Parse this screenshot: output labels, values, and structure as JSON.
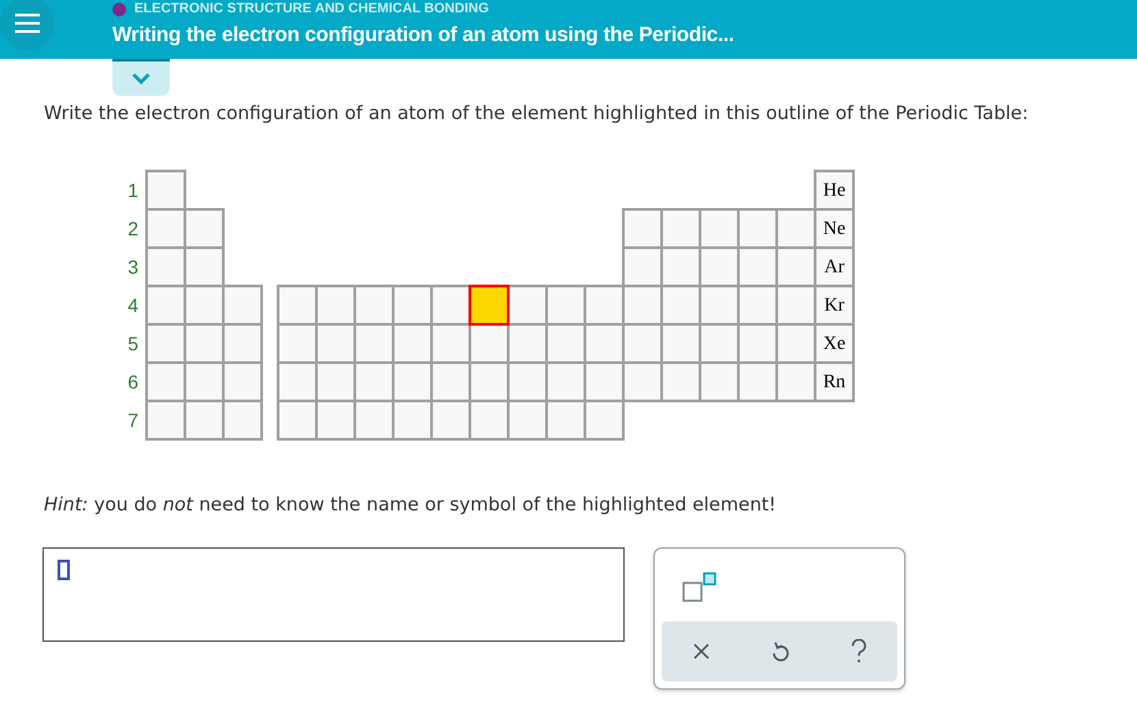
{
  "header": {
    "category": "ELECTRONIC STRUCTURE AND CHEMICAL BONDING",
    "title": "Writing the electron configuration of an atom using the Periodic..."
  },
  "question": "Write the electron configuration of an atom of the element highlighted in this outline of the Periodic Table:",
  "periodic_table": {
    "rows": [
      {
        "label": "1",
        "cells": [
          {
            "kind": "box",
            "highlighted": false
          },
          {
            "kind": "none"
          },
          {
            "kind": "none"
          },
          {
            "kind": "none"
          },
          {
            "kind": "none"
          },
          {
            "kind": "none"
          },
          {
            "kind": "none"
          },
          {
            "kind": "none"
          },
          {
            "kind": "none"
          },
          {
            "kind": "none"
          },
          {
            "kind": "none"
          },
          {
            "kind": "none"
          },
          {
            "kind": "none"
          },
          {
            "kind": "none"
          },
          {
            "kind": "none"
          },
          {
            "kind": "none"
          },
          {
            "kind": "none"
          },
          {
            "kind": "box",
            "highlighted": false,
            "symbol": "He"
          }
        ]
      },
      {
        "label": "2",
        "cells": [
          {
            "kind": "box",
            "highlighted": false
          },
          {
            "kind": "box",
            "highlighted": false
          },
          {
            "kind": "none"
          },
          {
            "kind": "none"
          },
          {
            "kind": "none"
          },
          {
            "kind": "none"
          },
          {
            "kind": "none"
          },
          {
            "kind": "none"
          },
          {
            "kind": "none"
          },
          {
            "kind": "none"
          },
          {
            "kind": "none"
          },
          {
            "kind": "none"
          },
          {
            "kind": "box",
            "highlighted": false
          },
          {
            "kind": "box",
            "highlighted": false
          },
          {
            "kind": "box",
            "highlighted": false
          },
          {
            "kind": "box",
            "highlighted": false
          },
          {
            "kind": "box",
            "highlighted": false
          },
          {
            "kind": "box",
            "highlighted": false,
            "symbol": "Ne"
          }
        ]
      },
      {
        "label": "3",
        "cells": [
          {
            "kind": "box",
            "highlighted": false
          },
          {
            "kind": "box",
            "highlighted": false
          },
          {
            "kind": "none"
          },
          {
            "kind": "none"
          },
          {
            "kind": "none"
          },
          {
            "kind": "none"
          },
          {
            "kind": "none"
          },
          {
            "kind": "none"
          },
          {
            "kind": "none"
          },
          {
            "kind": "none"
          },
          {
            "kind": "none"
          },
          {
            "kind": "none"
          },
          {
            "kind": "box",
            "highlighted": false
          },
          {
            "kind": "box",
            "highlighted": false
          },
          {
            "kind": "box",
            "highlighted": false
          },
          {
            "kind": "box",
            "highlighted": false
          },
          {
            "kind": "box",
            "highlighted": false
          },
          {
            "kind": "box",
            "highlighted": false,
            "symbol": "Ar"
          }
        ]
      },
      {
        "label": "4",
        "cells": [
          {
            "kind": "box",
            "highlighted": false
          },
          {
            "kind": "box",
            "highlighted": false
          },
          {
            "kind": "box",
            "highlighted": false
          },
          {
            "kind": "box",
            "highlighted": false
          },
          {
            "kind": "box",
            "highlighted": false
          },
          {
            "kind": "box",
            "highlighted": false
          },
          {
            "kind": "box",
            "highlighted": false
          },
          {
            "kind": "box",
            "highlighted": false
          },
          {
            "kind": "box",
            "highlighted": true
          },
          {
            "kind": "box",
            "highlighted": false
          },
          {
            "kind": "box",
            "highlighted": false
          },
          {
            "kind": "box",
            "highlighted": false
          },
          {
            "kind": "box",
            "highlighted": false
          },
          {
            "kind": "box",
            "highlighted": false
          },
          {
            "kind": "box",
            "highlighted": false
          },
          {
            "kind": "box",
            "highlighted": false
          },
          {
            "kind": "box",
            "highlighted": false
          },
          {
            "kind": "box",
            "highlighted": false,
            "symbol": "Kr"
          }
        ]
      },
      {
        "label": "5",
        "cells": [
          {
            "kind": "box",
            "highlighted": false
          },
          {
            "kind": "box",
            "highlighted": false
          },
          {
            "kind": "box",
            "highlighted": false
          },
          {
            "kind": "box",
            "highlighted": false
          },
          {
            "kind": "box",
            "highlighted": false
          },
          {
            "kind": "box",
            "highlighted": false
          },
          {
            "kind": "box",
            "highlighted": false
          },
          {
            "kind": "box",
            "highlighted": false
          },
          {
            "kind": "box",
            "highlighted": false
          },
          {
            "kind": "box",
            "highlighted": false
          },
          {
            "kind": "box",
            "highlighted": false
          },
          {
            "kind": "box",
            "highlighted": false
          },
          {
            "kind": "box",
            "highlighted": false
          },
          {
            "kind": "box",
            "highlighted": false
          },
          {
            "kind": "box",
            "highlighted": false
          },
          {
            "kind": "box",
            "highlighted": false
          },
          {
            "kind": "box",
            "highlighted": false
          },
          {
            "kind": "box",
            "highlighted": false,
            "symbol": "Xe"
          }
        ]
      },
      {
        "label": "6",
        "cells": [
          {
            "kind": "box",
            "highlighted": false
          },
          {
            "kind": "box",
            "highlighted": false
          },
          {
            "kind": "box",
            "highlighted": false
          },
          {
            "kind": "box",
            "highlighted": false
          },
          {
            "kind": "box",
            "highlighted": false
          },
          {
            "kind": "box",
            "highlighted": false
          },
          {
            "kind": "box",
            "highlighted": false
          },
          {
            "kind": "box",
            "highlighted": false
          },
          {
            "kind": "box",
            "highlighted": false
          },
          {
            "kind": "box",
            "highlighted": false
          },
          {
            "kind": "box",
            "highlighted": false
          },
          {
            "kind": "box",
            "highlighted": false
          },
          {
            "kind": "box",
            "highlighted": false
          },
          {
            "kind": "box",
            "highlighted": false
          },
          {
            "kind": "box",
            "highlighted": false
          },
          {
            "kind": "box",
            "highlighted": false
          },
          {
            "kind": "box",
            "highlighted": false
          },
          {
            "kind": "box",
            "highlighted": false,
            "symbol": "Rn"
          }
        ]
      },
      {
        "label": "7",
        "cells": [
          {
            "kind": "box",
            "highlighted": false
          },
          {
            "kind": "box",
            "highlighted": false
          },
          {
            "kind": "box",
            "highlighted": false
          },
          {
            "kind": "box",
            "highlighted": false
          },
          {
            "kind": "box",
            "highlighted": false
          },
          {
            "kind": "box",
            "highlighted": false
          },
          {
            "kind": "box",
            "highlighted": false
          },
          {
            "kind": "box",
            "highlighted": false
          },
          {
            "kind": "box",
            "highlighted": false
          },
          {
            "kind": "box",
            "highlighted": false
          },
          {
            "kind": "box",
            "highlighted": false
          },
          {
            "kind": "box",
            "highlighted": false
          },
          {
            "kind": "none"
          },
          {
            "kind": "none"
          },
          {
            "kind": "none"
          },
          {
            "kind": "none"
          },
          {
            "kind": "none"
          },
          {
            "kind": "none"
          }
        ]
      }
    ]
  },
  "hint": "*Hint:* you do *not* need to know the name or symbol of the highlighted element!",
  "answer": {
    "kind": "empty"
  }
}
